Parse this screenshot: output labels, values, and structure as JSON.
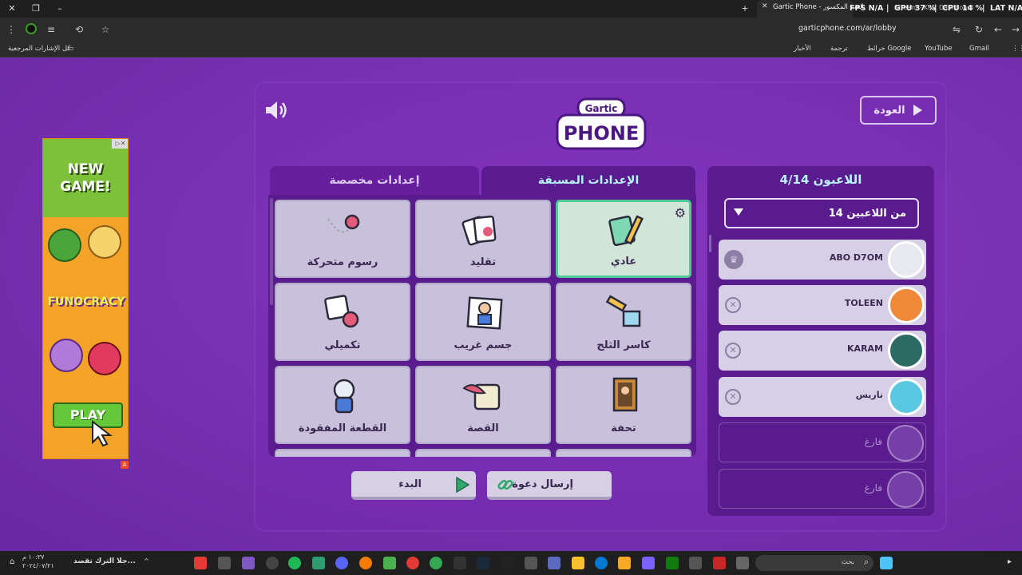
{
  "browser": {
    "tab_title": "Gartic Phone - العب المكسور",
    "tab2_title": "Stream - Kick Dashboard",
    "url": "garticphone.com/ar/lobby",
    "perf": {
      "fps": "FPS  N/A",
      "gpu": "GPU  37 %",
      "cpu": "CPU  14 %",
      "lat": "LAT  N/A"
    },
    "bookmarks": {
      "all": "كل الإشارات المرجعية",
      "gmail": "Gmail",
      "youtube": "YouTube",
      "maps": "خرائط Google",
      "translate": "ترجمة",
      "news": "الأخبار"
    }
  },
  "ad": {
    "headline": "NEW GAME!",
    "brand": "FUNOCRACY",
    "cta": "PLAY",
    "choice": "A"
  },
  "header": {
    "back_label": "العودة",
    "logo_top": "Gartic",
    "logo_bottom": "PHONE"
  },
  "tabs": {
    "preset": "الإعدادات المسبقة",
    "custom": "إعدادات مخصصة"
  },
  "modes": [
    {
      "label": "عادي",
      "selected": true
    },
    {
      "label": "تقليد",
      "selected": false
    },
    {
      "label": "رسوم متحركة",
      "selected": false
    },
    {
      "label": "كاسر الثلج",
      "selected": false
    },
    {
      "label": "جسم غريب",
      "selected": false
    },
    {
      "label": "تكميلي",
      "selected": false
    },
    {
      "label": "تحفة",
      "selected": false
    },
    {
      "label": "القصة",
      "selected": false
    },
    {
      "label": "القطعة المفقودة",
      "selected": false
    }
  ],
  "players": {
    "title": "اللاعبون 4/14",
    "count_select": "14 من اللاعبين",
    "list": [
      {
        "name": "ABO D7OM",
        "host": true
      },
      {
        "name": "TOLEEN",
        "host": false
      },
      {
        "name": "KARAM",
        "host": false
      },
      {
        "name": "ناريس",
        "host": false
      },
      {
        "name": "فارغ",
        "empty": true
      },
      {
        "name": "فارغ",
        "empty": true
      }
    ]
  },
  "actions": {
    "invite": "إرسال دعوة",
    "start": "البدء"
  },
  "taskbar": {
    "search_placeholder": "بحث",
    "time": "١٠:٣٧ م",
    "date": "٢٠٢٤/٠٧/٢١",
    "notification": "جلا الترك تقصد..."
  },
  "colors": {
    "page_bg": "#7a2fb3",
    "panel_dark": "#5a1b8f",
    "accent_cyan": "#b8f3ff",
    "selected_border": "#4fc99a"
  }
}
